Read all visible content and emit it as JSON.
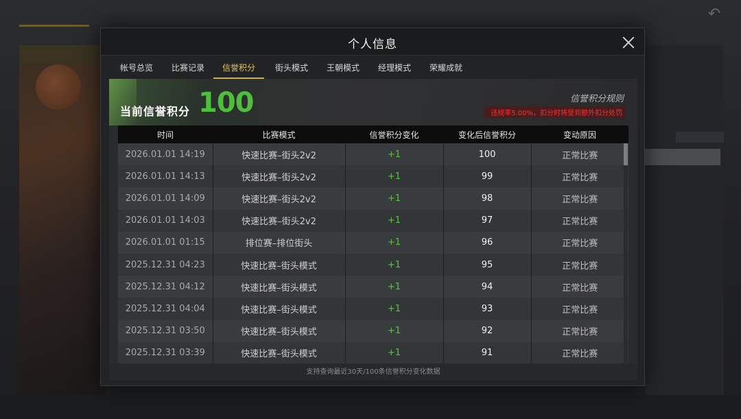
{
  "modal": {
    "title": "个人信息",
    "tabs": [
      {
        "label": "帐号总览"
      },
      {
        "label": "比赛记录"
      },
      {
        "label": "信誉积分"
      },
      {
        "label": "街头模式"
      },
      {
        "label": "王朝模式"
      },
      {
        "label": "经理模式"
      },
      {
        "label": "荣耀成就"
      }
    ],
    "active_tab": 2
  },
  "panel": {
    "score_label": "当前信誉积分",
    "score_value": "100",
    "rule_link": "信誉积分规则",
    "warning": "违规率5.00%，扣分时将受到额外扣分处罚",
    "footer_note": "支持查询最近30天/100条信誉积分变化数据"
  },
  "table": {
    "headers": [
      "时间",
      "比赛模式",
      "信誉积分变化",
      "变化后信誉积分",
      "变动原因"
    ],
    "rows": [
      [
        "2026.01.01  14:19",
        "快速比赛–街头2v2",
        "+1",
        "100",
        "正常比赛"
      ],
      [
        "2026.01.01  14:13",
        "快速比赛–街头2v2",
        "+1",
        "99",
        "正常比赛"
      ],
      [
        "2026.01.01  14:09",
        "快速比赛–街头2v2",
        "+1",
        "98",
        "正常比赛"
      ],
      [
        "2026.01.01  14:03",
        "快速比赛–街头2v2",
        "+1",
        "97",
        "正常比赛"
      ],
      [
        "2026.01.01  01:15",
        "排位赛–排位街头",
        "+1",
        "96",
        "正常比赛"
      ],
      [
        "2025.12.31  04:23",
        "快速比赛–街头模式",
        "+1",
        "95",
        "正常比赛"
      ],
      [
        "2025.12.31  04:12",
        "快速比赛–街头模式",
        "+1",
        "94",
        "正常比赛"
      ],
      [
        "2025.12.31  04:04",
        "快速比赛–街头模式",
        "+1",
        "93",
        "正常比赛"
      ],
      [
        "2025.12.31  03:50",
        "快速比赛–街头模式",
        "+1",
        "92",
        "正常比赛"
      ],
      [
        "2025.12.31  03:39",
        "快速比赛–街头模式",
        "+1",
        "91",
        "正常比赛"
      ]
    ]
  },
  "colors": {
    "accent_gold": "#d4ae45",
    "score_green": "#4fbe3c",
    "change_green": "#56c544",
    "warning_red": "#e33333"
  },
  "icons": {
    "close": "close-icon",
    "back": "back-arrow-icon"
  }
}
